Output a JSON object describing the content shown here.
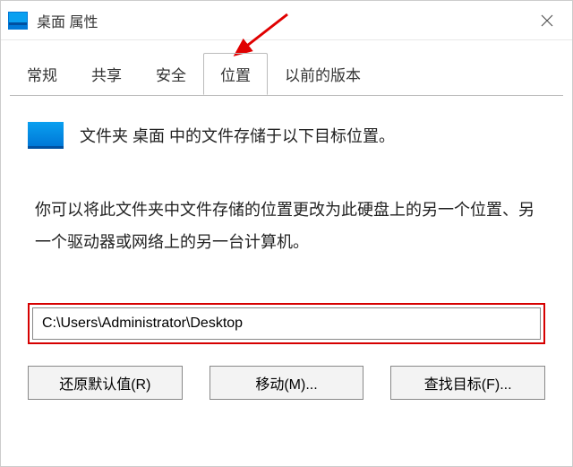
{
  "titlebar": {
    "title": "桌面 属性"
  },
  "tabs": {
    "items": [
      {
        "label": "常规"
      },
      {
        "label": "共享"
      },
      {
        "label": "安全"
      },
      {
        "label": "位置"
      },
      {
        "label": "以前的版本"
      }
    ],
    "active_index": 3
  },
  "content": {
    "intro": "文件夹 桌面 中的文件存储于以下目标位置。",
    "info": "你可以将此文件夹中文件存储的位置更改为此硬盘上的另一个位置、另一个驱动器或网络上的另一台计算机。",
    "path": "C:\\Users\\Administrator\\Desktop"
  },
  "buttons": {
    "restore": "还原默认值(R)",
    "move": "移动(M)...",
    "find": "查找目标(F)..."
  }
}
